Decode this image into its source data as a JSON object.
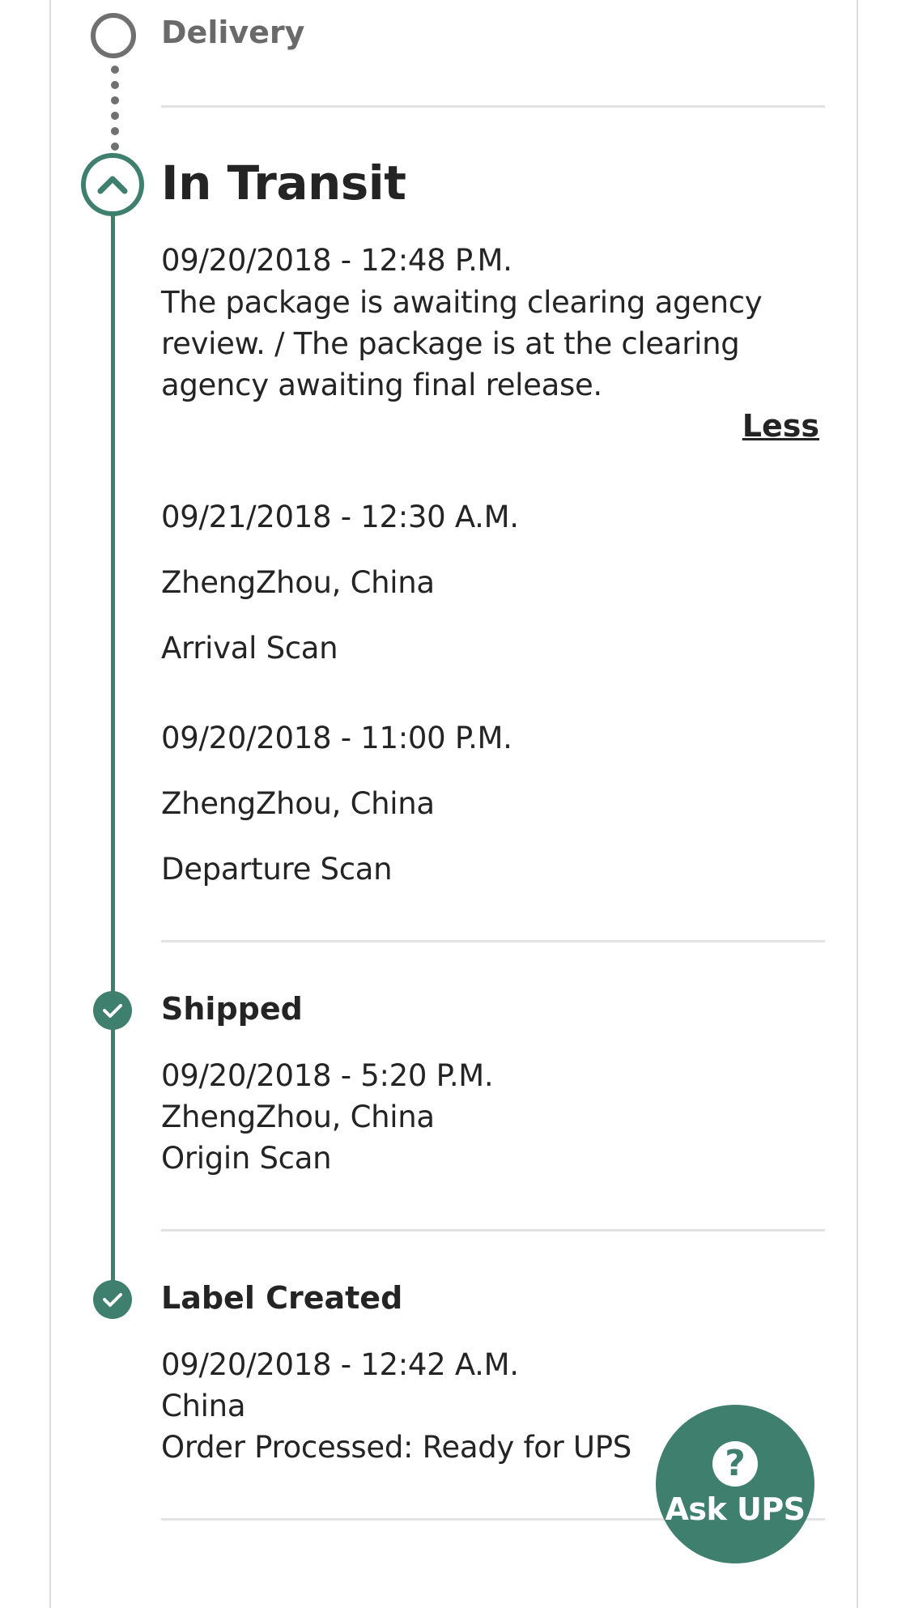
{
  "timeline": {
    "delivery": {
      "label": "Delivery"
    },
    "in_transit": {
      "label": "In Transit",
      "summary_datetime": "09/20/2018 - 12:48 P.M.",
      "summary_line1": "The package is awaiting clearing agency",
      "summary_line2": "review. / The package is at the clearing",
      "summary_line3": "agency awaiting final release.",
      "less_link": "Less",
      "events": [
        {
          "datetime": "09/21/2018 - 12:30 A.M.",
          "location": "ZhengZhou, China",
          "activity": "Arrival Scan"
        },
        {
          "datetime": "09/20/2018 - 11:00 P.M.",
          "location": "ZhengZhou, China",
          "activity": "Departure Scan"
        }
      ]
    },
    "shipped": {
      "label": "Shipped",
      "datetime": "09/20/2018 - 5:20 P.M.",
      "location": "ZhengZhou, China",
      "activity": "Origin Scan"
    },
    "label_created": {
      "label": "Label Created",
      "datetime": "09/20/2018 - 12:42 A.M.",
      "location": "China",
      "activity": "Order Processed: Ready for UPS"
    }
  },
  "ask_ups": {
    "icon": "question-circle-icon",
    "label": "Ask UPS"
  },
  "colors": {
    "accent": "#3f7f6e",
    "muted": "#707070",
    "text": "#242424",
    "divider": "#e2e2e2"
  }
}
